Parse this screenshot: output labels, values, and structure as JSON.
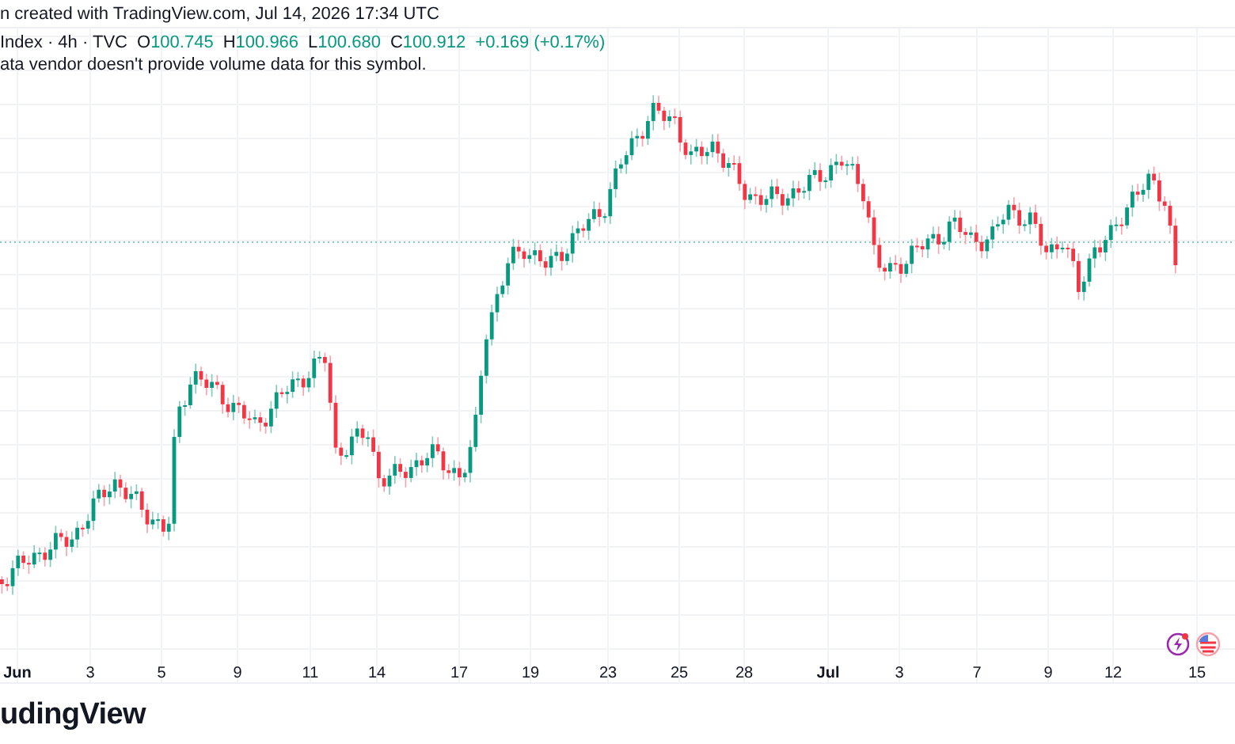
{
  "header": {
    "caption": "n created with TradingView.com, Jul 14, 2026 17:34 UTC"
  },
  "legend": {
    "symbol": "Index · 4h · TVC",
    "values": [
      {
        "label": "O",
        "value": "100.745"
      },
      {
        "label": "H",
        "value": "100.966"
      },
      {
        "label": "L",
        "value": "100.680"
      },
      {
        "label": "C",
        "value": "100.912"
      }
    ],
    "change": "+0.169 (+0.17%)",
    "notice": "ata vendor doesn't provide volume data for this symbol."
  },
  "x_axis": {
    "labels": [
      {
        "text": "Jun",
        "kind": "month"
      },
      {
        "text": "3",
        "kind": "day"
      },
      {
        "text": "5",
        "kind": "day"
      },
      {
        "text": "9",
        "kind": "day"
      },
      {
        "text": "11",
        "kind": "day"
      },
      {
        "text": "14",
        "kind": "day"
      },
      {
        "text": "17",
        "kind": "day"
      },
      {
        "text": "19",
        "kind": "day"
      },
      {
        "text": "23",
        "kind": "day"
      },
      {
        "text": "25",
        "kind": "day"
      },
      {
        "text": "28",
        "kind": "day"
      },
      {
        "text": "Jul",
        "kind": "month"
      },
      {
        "text": "3",
        "kind": "day"
      },
      {
        "text": "7",
        "kind": "day"
      },
      {
        "text": "9",
        "kind": "day"
      },
      {
        "text": "12",
        "kind": "day"
      },
      {
        "text": "15",
        "kind": "day"
      }
    ]
  },
  "footer": {
    "logo_text": "udingView"
  }
}
